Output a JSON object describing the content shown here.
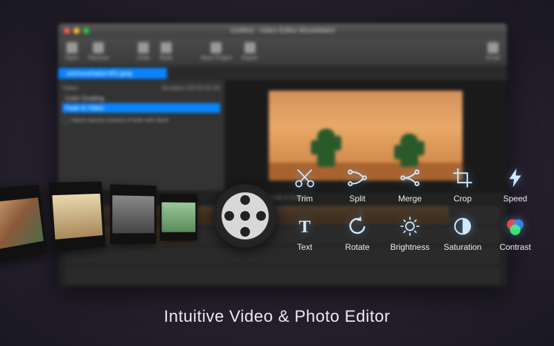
{
  "window": {
    "title": "Untitled - Video Editor MovieMator"
  },
  "toolbar": {
    "open": "Open",
    "remove": "Remove",
    "undo": "Undo",
    "redo": "Redo",
    "save_project": "Save Project",
    "export": "Export",
    "email": "Email"
  },
  "tab": {
    "filename": "xsichoushadui-001.jpeg"
  },
  "panel": {
    "header": "Video",
    "duration_label": "Duration",
    "duration_value": "00:00:01:00",
    "item1": "Color Grading",
    "item2": "Fade In Video",
    "opt": "Adjust opacity instead of fade with black"
  },
  "timeline": {
    "header": "Timecode in frames"
  },
  "features": {
    "trim": "Trim",
    "split": "Split",
    "merge": "Merge",
    "crop": "Crop",
    "speed": "Speed",
    "text": "Text",
    "rotate": "Rotate",
    "brightness": "Brightness",
    "saturation": "Saturation",
    "contrast": "Contrast"
  },
  "tagline": "Intuitive Video & Photo Editor"
}
